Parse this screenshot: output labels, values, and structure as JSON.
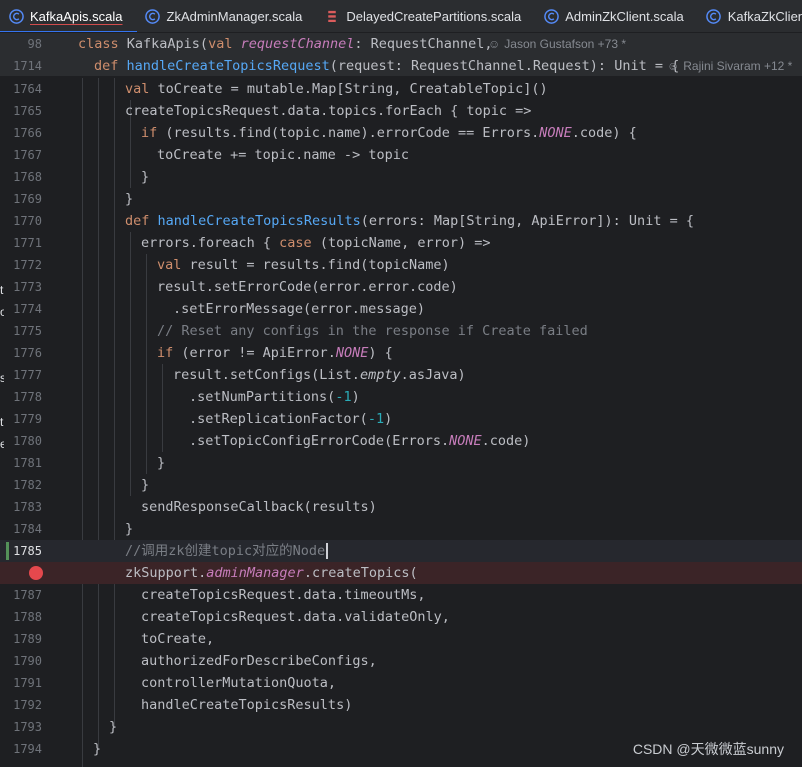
{
  "tabs": [
    {
      "label": "KafkaApis.scala",
      "icon": "scala-class-icon",
      "active": true
    },
    {
      "label": "ZkAdminManager.scala",
      "icon": "scala-class-icon",
      "active": false
    },
    {
      "label": "DelayedCreatePartitions.scala",
      "icon": "scala-file-icon",
      "active": false
    },
    {
      "label": "AdminZkClient.scala",
      "icon": "scala-class-icon",
      "active": false
    },
    {
      "label": "KafkaZkClient.s",
      "icon": "scala-class-icon",
      "active": false
    }
  ],
  "sticky": [
    {
      "line": "98",
      "author": "Jason Gustafson +73 *"
    },
    {
      "line": "1714",
      "author": "Rajini Sivaram +12 *"
    }
  ],
  "lines": {
    "l1764": "1764",
    "l1765": "1765",
    "l1766": "1766",
    "l1767": "1767",
    "l1768": "1768",
    "l1769": "1769",
    "l1770": "1770",
    "l1771": "1771",
    "l1772": "1772",
    "l1773": "1773",
    "l1774": "1774",
    "l1775": "1775",
    "l1776": "1776",
    "l1777": "1777",
    "l1778": "1778",
    "l1779": "1779",
    "l1780": "1780",
    "l1781": "1781",
    "l1782": "1782",
    "l1783": "1783",
    "l1784": "1784",
    "l1785": "1785",
    "l1787": "1787",
    "l1788": "1788",
    "l1789": "1789",
    "l1790": "1790",
    "l1791": "1791",
    "l1792": "1792",
    "l1793": "1793",
    "l1794": "1794"
  },
  "code": {
    "s98_class": "class ",
    "s98_name": "KafkaApis(",
    "s98_val": "val ",
    "s98_field": "requestChannel",
    "s98_rest": ": RequestChannel,",
    "s1714_def": "def ",
    "s1714_fn": "handleCreateTopicsRequest",
    "s1714_rest": "(request: RequestChannel.Request): Unit = {",
    "c1764_val": "val ",
    "c1764_rest": "toCreate = mutable.Map[String, CreatableTopic]()",
    "c1765": "createTopicsRequest.data.topics.forEach { topic =>",
    "c1766_if": "if ",
    "c1766_a": "(results.find(topic.name).errorCode == Errors.",
    "c1766_none": "NONE",
    "c1766_b": ".code) {",
    "c1767": "toCreate += topic.name -> topic",
    "c1768": "}",
    "c1769": "}",
    "c1770_def": "def ",
    "c1770_fn": "handleCreateTopicsResults",
    "c1770_rest": "(errors: Map[String, ApiError]): Unit = {",
    "c1771_a": "errors.foreach { ",
    "c1771_case": "case ",
    "c1771_b": "(topicName, error) =>",
    "c1772_val": "val ",
    "c1772_rest": "result = results.find(topicName)",
    "c1773": "result.setErrorCode(error.error.code)",
    "c1774": ".setErrorMessage(error.message)",
    "c1775": "// Reset any configs in the response if Create failed",
    "c1776_if": "if ",
    "c1776_a": "(error != ApiError.",
    "c1776_none": "NONE",
    "c1776_b": ") {",
    "c1777_a": "result.setConfigs(List.",
    "c1777_empty": "empty",
    "c1777_b": ".asJava)",
    "c1778_a": ".setNumPartitions(",
    "c1778_num": "-1",
    "c1778_b": ")",
    "c1779_a": ".setReplicationFactor(",
    "c1779_num": "-1",
    "c1779_b": ")",
    "c1780_a": ".setTopicConfigErrorCode(Errors.",
    "c1780_none": "NONE",
    "c1780_b": ".code)",
    "c1781": "}",
    "c1782": "}",
    "c1783": "sendResponseCallback(results)",
    "c1784": "}",
    "c1785": "//调用zk创建topic对应的Node",
    "c1786_a": "zkSupport.",
    "c1786_field": "adminManager",
    "c1786_b": ".createTopics(",
    "c1787": "createTopicsRequest.data.timeoutMs,",
    "c1788": "createTopicsRequest.data.validateOnly,",
    "c1789": "toCreate,",
    "c1790": "authorizedForDescribeConfigs,",
    "c1791": "controllerMutationQuota,",
    "c1792": "handleCreateTopicsResults)",
    "c1793": "}",
    "c1794": "}"
  },
  "left_edge_chars": [
    "t",
    "o",
    "s",
    "t",
    "e"
  ],
  "watermark": "CSDN @天微微蓝sunny",
  "colors": {
    "keyword": "#cf8e6d",
    "function": "#56a8f5",
    "field": "#c77dbb",
    "number": "#2aacb8",
    "comment": "#7a7e85",
    "breakpoint": "#e5484d",
    "accent": "#3574f0"
  }
}
